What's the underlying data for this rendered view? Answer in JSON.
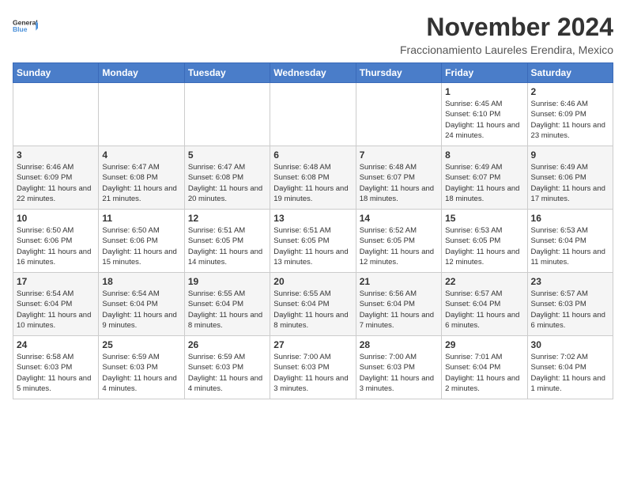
{
  "logo": {
    "general": "General",
    "blue": "Blue"
  },
  "header": {
    "month_title": "November 2024",
    "subtitle": "Fraccionamiento Laureles Erendira, Mexico"
  },
  "weekdays": [
    "Sunday",
    "Monday",
    "Tuesday",
    "Wednesday",
    "Thursday",
    "Friday",
    "Saturday"
  ],
  "weeks": [
    [
      {
        "day": "",
        "info": ""
      },
      {
        "day": "",
        "info": ""
      },
      {
        "day": "",
        "info": ""
      },
      {
        "day": "",
        "info": ""
      },
      {
        "day": "",
        "info": ""
      },
      {
        "day": "1",
        "info": "Sunrise: 6:45 AM\nSunset: 6:10 PM\nDaylight: 11 hours and 24 minutes."
      },
      {
        "day": "2",
        "info": "Sunrise: 6:46 AM\nSunset: 6:09 PM\nDaylight: 11 hours and 23 minutes."
      }
    ],
    [
      {
        "day": "3",
        "info": "Sunrise: 6:46 AM\nSunset: 6:09 PM\nDaylight: 11 hours and 22 minutes."
      },
      {
        "day": "4",
        "info": "Sunrise: 6:47 AM\nSunset: 6:08 PM\nDaylight: 11 hours and 21 minutes."
      },
      {
        "day": "5",
        "info": "Sunrise: 6:47 AM\nSunset: 6:08 PM\nDaylight: 11 hours and 20 minutes."
      },
      {
        "day": "6",
        "info": "Sunrise: 6:48 AM\nSunset: 6:08 PM\nDaylight: 11 hours and 19 minutes."
      },
      {
        "day": "7",
        "info": "Sunrise: 6:48 AM\nSunset: 6:07 PM\nDaylight: 11 hours and 18 minutes."
      },
      {
        "day": "8",
        "info": "Sunrise: 6:49 AM\nSunset: 6:07 PM\nDaylight: 11 hours and 18 minutes."
      },
      {
        "day": "9",
        "info": "Sunrise: 6:49 AM\nSunset: 6:06 PM\nDaylight: 11 hours and 17 minutes."
      }
    ],
    [
      {
        "day": "10",
        "info": "Sunrise: 6:50 AM\nSunset: 6:06 PM\nDaylight: 11 hours and 16 minutes."
      },
      {
        "day": "11",
        "info": "Sunrise: 6:50 AM\nSunset: 6:06 PM\nDaylight: 11 hours and 15 minutes."
      },
      {
        "day": "12",
        "info": "Sunrise: 6:51 AM\nSunset: 6:05 PM\nDaylight: 11 hours and 14 minutes."
      },
      {
        "day": "13",
        "info": "Sunrise: 6:51 AM\nSunset: 6:05 PM\nDaylight: 11 hours and 13 minutes."
      },
      {
        "day": "14",
        "info": "Sunrise: 6:52 AM\nSunset: 6:05 PM\nDaylight: 11 hours and 12 minutes."
      },
      {
        "day": "15",
        "info": "Sunrise: 6:53 AM\nSunset: 6:05 PM\nDaylight: 11 hours and 12 minutes."
      },
      {
        "day": "16",
        "info": "Sunrise: 6:53 AM\nSunset: 6:04 PM\nDaylight: 11 hours and 11 minutes."
      }
    ],
    [
      {
        "day": "17",
        "info": "Sunrise: 6:54 AM\nSunset: 6:04 PM\nDaylight: 11 hours and 10 minutes."
      },
      {
        "day": "18",
        "info": "Sunrise: 6:54 AM\nSunset: 6:04 PM\nDaylight: 11 hours and 9 minutes."
      },
      {
        "day": "19",
        "info": "Sunrise: 6:55 AM\nSunset: 6:04 PM\nDaylight: 11 hours and 8 minutes."
      },
      {
        "day": "20",
        "info": "Sunrise: 6:55 AM\nSunset: 6:04 PM\nDaylight: 11 hours and 8 minutes."
      },
      {
        "day": "21",
        "info": "Sunrise: 6:56 AM\nSunset: 6:04 PM\nDaylight: 11 hours and 7 minutes."
      },
      {
        "day": "22",
        "info": "Sunrise: 6:57 AM\nSunset: 6:04 PM\nDaylight: 11 hours and 6 minutes."
      },
      {
        "day": "23",
        "info": "Sunrise: 6:57 AM\nSunset: 6:03 PM\nDaylight: 11 hours and 6 minutes."
      }
    ],
    [
      {
        "day": "24",
        "info": "Sunrise: 6:58 AM\nSunset: 6:03 PM\nDaylight: 11 hours and 5 minutes."
      },
      {
        "day": "25",
        "info": "Sunrise: 6:59 AM\nSunset: 6:03 PM\nDaylight: 11 hours and 4 minutes."
      },
      {
        "day": "26",
        "info": "Sunrise: 6:59 AM\nSunset: 6:03 PM\nDaylight: 11 hours and 4 minutes."
      },
      {
        "day": "27",
        "info": "Sunrise: 7:00 AM\nSunset: 6:03 PM\nDaylight: 11 hours and 3 minutes."
      },
      {
        "day": "28",
        "info": "Sunrise: 7:00 AM\nSunset: 6:03 PM\nDaylight: 11 hours and 3 minutes."
      },
      {
        "day": "29",
        "info": "Sunrise: 7:01 AM\nSunset: 6:04 PM\nDaylight: 11 hours and 2 minutes."
      },
      {
        "day": "30",
        "info": "Sunrise: 7:02 AM\nSunset: 6:04 PM\nDaylight: 11 hours and 1 minute."
      }
    ]
  ]
}
